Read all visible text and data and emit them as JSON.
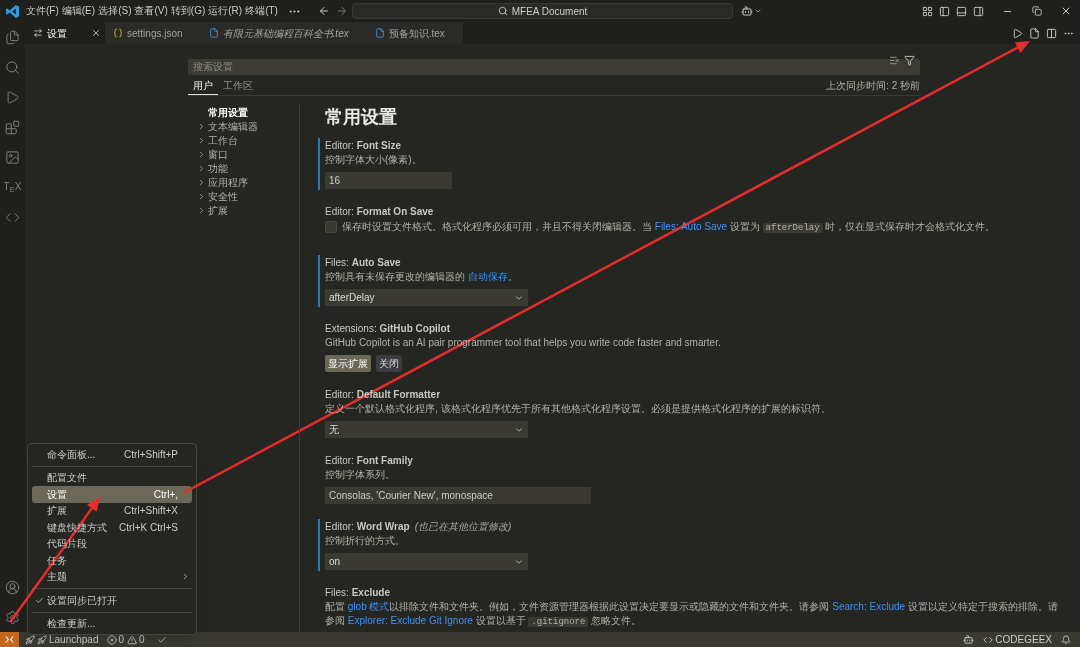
{
  "title_bar": {
    "menu": [
      "文件(F)",
      "编辑(E)",
      "选择(S)",
      "查看(V)",
      "转到(G)",
      "运行(R)",
      "终端(T)"
    ],
    "command_center": "MFEA Document"
  },
  "activity_bar": {
    "tex_label": "T$_{E}$X"
  },
  "tabs": [
    {
      "kind": "settings",
      "label": "设置",
      "selected": true,
      "preview": false
    },
    {
      "kind": "json",
      "label": "settings.json",
      "selected": false,
      "preview": false
    },
    {
      "kind": "tex",
      "label": "有限元基础编程百科全书.tex",
      "selected": false,
      "preview": true
    },
    {
      "kind": "tex",
      "label": "预备知识.tex",
      "selected": false,
      "preview": false
    }
  ],
  "settings_editor": {
    "search": {
      "placeholder": "搜索设置"
    },
    "scope_tabs": [
      {
        "label": "用户",
        "selected": true
      },
      {
        "label": "工作区",
        "selected": false
      }
    ],
    "sync_status": "上次同步时间: 2 秒前",
    "toc": [
      {
        "label": "常用设置",
        "selected": true,
        "expandable": false
      },
      {
        "label": "文本编辑器",
        "selected": false,
        "expandable": true
      },
      {
        "label": "工作台",
        "selected": false,
        "expandable": true
      },
      {
        "label": "窗口",
        "selected": false,
        "expandable": true
      },
      {
        "label": "功能",
        "selected": false,
        "expandable": true
      },
      {
        "label": "应用程序",
        "selected": false,
        "expandable": true
      },
      {
        "label": "安全性",
        "selected": false,
        "expandable": true
      },
      {
        "label": "扩展",
        "selected": false,
        "expandable": true
      }
    ],
    "heading": "常用设置",
    "settings": [
      {
        "kind": "number",
        "title": "Editor: **Font Size**",
        "modified": true,
        "description": [
          {
            "kind": "text",
            "text": "控制字体大小(像素)。"
          }
        ],
        "value": "16"
      },
      {
        "kind": "checkbox",
        "title": "Editor: **Format On Save**",
        "modified": false,
        "checked": false,
        "description": [
          {
            "kind": "text",
            "text": "保存时设置文件格式。格式化程序必须可用，并且不得关闭编辑器。当 "
          },
          {
            "kind": "link",
            "text": "Files: Auto Save"
          },
          {
            "kind": "text",
            "text": " 设置为 "
          },
          {
            "kind": "code",
            "text": "afterDelay"
          },
          {
            "kind": "text",
            "text": " 时，仅在显式保存时才会格式化文件。"
          }
        ]
      },
      {
        "kind": "select",
        "title": "Files: **Auto Save**",
        "modified": true,
        "description": [
          {
            "kind": "text",
            "text": "控制具有未保存更改的编辑器的 "
          },
          {
            "kind": "link",
            "text": "自动保存"
          },
          {
            "kind": "text",
            "text": "。"
          }
        ],
        "value": "afterDelay"
      },
      {
        "kind": "buttons",
        "title": "Extensions: **GitHub Copilot**",
        "modified": false,
        "description": [
          {
            "kind": "text",
            "text": "GitHub Copilot is an AI pair programmer tool that helps you write code faster and smarter."
          }
        ],
        "buttons": [
          {
            "label": "显示扩展",
            "primary": true
          },
          {
            "label": "关闭",
            "primary": false
          }
        ]
      },
      {
        "kind": "select",
        "title": "Editor: **Default Formatter**",
        "modified": false,
        "description": [
          {
            "kind": "text",
            "text": "定义一个默认格式化程序, 该格式化程序优先于所有其他格式化程序设置。必须是提供格式化程序的扩展的标识符。"
          }
        ],
        "value": "无"
      },
      {
        "kind": "text",
        "title": "Editor: **Font Family**",
        "modified": false,
        "description": [
          {
            "kind": "text",
            "text": "控制字体系列。"
          }
        ],
        "value": "Consolas, 'Courier New', monospace"
      },
      {
        "kind": "select",
        "title": "Editor: **Word Wrap**",
        "note": "(也已在其他位置修改)",
        "modified": true,
        "description": [
          {
            "kind": "text",
            "text": "控制折行的方式。"
          }
        ],
        "value": "on"
      },
      {
        "kind": "list",
        "title": "Files: **Exclude**",
        "modified": false,
        "description": [
          {
            "kind": "text",
            "text": "配置 "
          },
          {
            "kind": "link",
            "text": "glob 模式"
          },
          {
            "kind": "text",
            "text": "以排除文件和文件夹。例如，文件资源管理器根据此设置决定要显示或隐藏的文件和文件夹。请参阅 "
          },
          {
            "kind": "link",
            "text": "Search: Exclude"
          },
          {
            "kind": "text",
            "text": " 设置以定义特定于搜索的排除。请参阅 "
          },
          {
            "kind": "link",
            "text": "Explorer: Exclude Git Ignore"
          },
          {
            "kind": "text",
            "text": " 设置以基于 "
          },
          {
            "kind": "code",
            "text": ".gitignore"
          },
          {
            "kind": "text",
            "text": " 忽略文件。"
          }
        ]
      }
    ]
  },
  "manage_menu": {
    "items": [
      {
        "kind": "item",
        "label": "命令面板...",
        "shortcut": "Ctrl+Shift+P",
        "selected": false
      },
      {
        "kind": "separator"
      },
      {
        "kind": "item",
        "label": "配置文件",
        "selected": false
      },
      {
        "kind": "item",
        "label": "设置",
        "shortcut": "Ctrl+,",
        "selected": true
      },
      {
        "kind": "item",
        "label": "扩展",
        "shortcut": "Ctrl+Shift+X",
        "selected": false
      },
      {
        "kind": "item",
        "label": "键盘快捷方式",
        "shortcut": "Ctrl+K Ctrl+S",
        "selected": false
      },
      {
        "kind": "item",
        "label": "代码片段",
        "selected": false
      },
      {
        "kind": "item",
        "label": "任务",
        "selected": false
      },
      {
        "kind": "submenu",
        "label": "主题",
        "selected": false
      },
      {
        "kind": "separator"
      },
      {
        "kind": "toggle",
        "label": "设置同步已打开",
        "checked": true,
        "selected": false
      },
      {
        "kind": "separator"
      },
      {
        "kind": "item",
        "label": "检查更新...",
        "selected": false
      }
    ]
  },
  "status_bar": {
    "launchpad": "Launchpad",
    "errors": "0",
    "warnings": "0",
    "codegeex": "CODEGEEX"
  }
}
